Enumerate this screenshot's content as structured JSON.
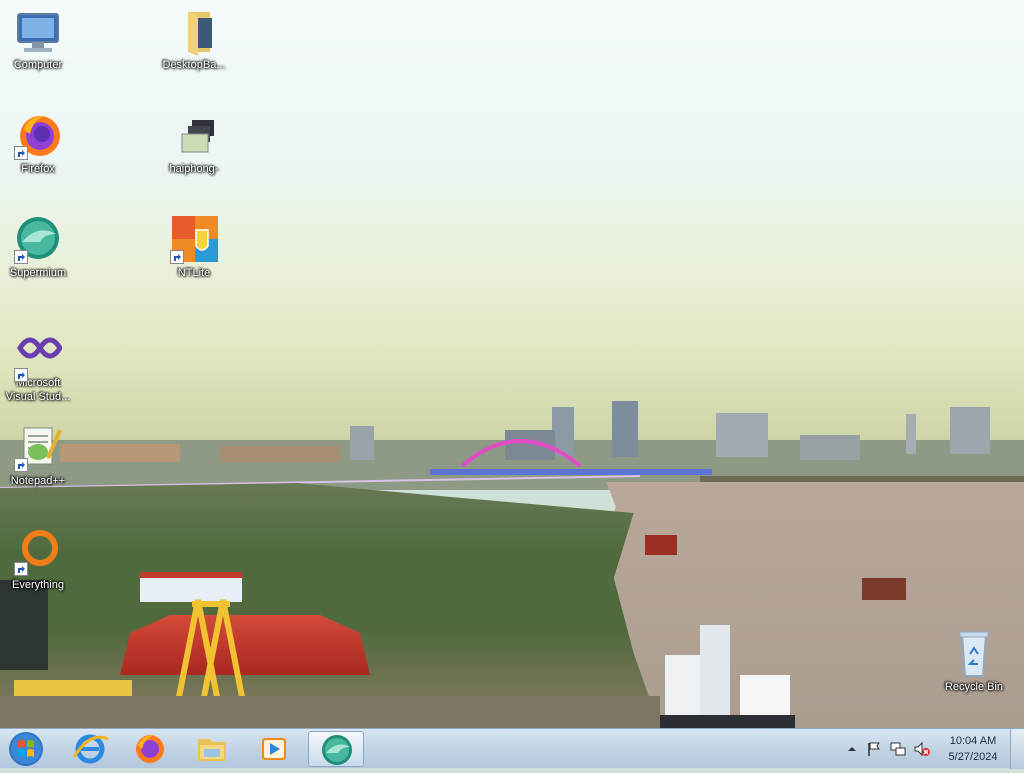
{
  "desktop": {
    "icons": [
      {
        "label": "Computer",
        "icon": "computer-icon"
      },
      {
        "label": "DesktopBa...",
        "icon": "folder-icon"
      },
      {
        "label": "Firefox",
        "icon": "firefox-icon"
      },
      {
        "label": "haiphong-",
        "icon": "image-stack-icon"
      },
      {
        "label": "Supermium",
        "icon": "supermium-icon"
      },
      {
        "label": "NTLite",
        "icon": "ntlite-icon"
      },
      {
        "label": "Microsoft Visual Stud...",
        "icon": "visual-studio-icon"
      },
      {
        "label": "Notepad++",
        "icon": "notepadpp-icon"
      },
      {
        "label": "Everything",
        "icon": "everything-icon"
      },
      {
        "label": "Recycle Bin",
        "icon": "recycle-bin-icon"
      }
    ]
  },
  "taskbar": {
    "pinned": [
      {
        "name": "internet-explorer-icon"
      },
      {
        "name": "firefox-icon"
      },
      {
        "name": "explorer-icon"
      },
      {
        "name": "media-player-icon"
      },
      {
        "name": "supermium-icon",
        "active": true
      }
    ],
    "clock": {
      "time": "10:04 AM",
      "date": "5/27/2024"
    }
  },
  "colors": {
    "taskbar_top": "#d9e6f2",
    "taskbar_bottom": "#b3c7dc",
    "label_text": "#ffffff"
  }
}
